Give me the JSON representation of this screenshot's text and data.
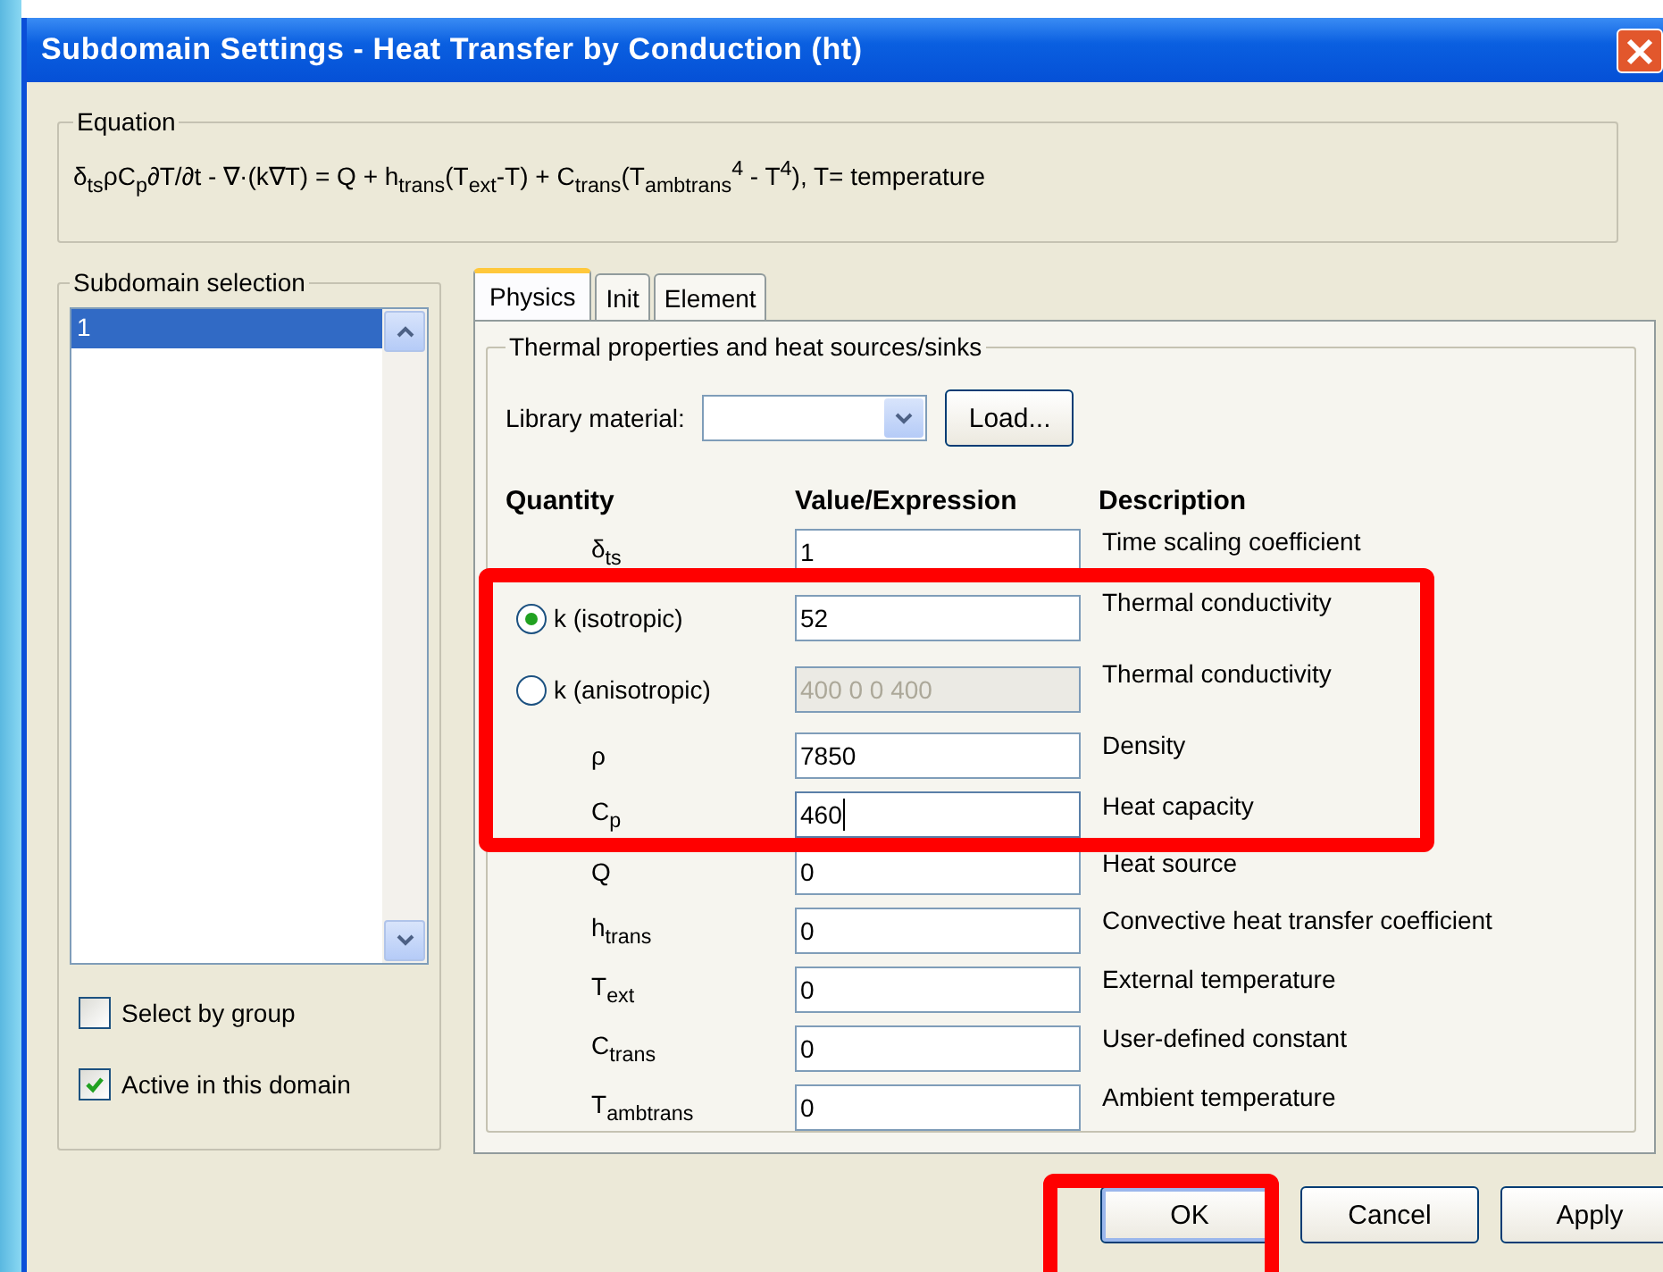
{
  "window": {
    "title": "Subdomain Settings - Heat Transfer by Conduction (ht)"
  },
  "equation": {
    "legend": "Equation",
    "formula": "δ$_{ts}$ρC$_{p}$∂T/∂t - ∇·(k∇T) = Q + h$_{trans}$(T$_{ext}$-T) + C$_{trans}$(T$_{ambtrans}$$^{4}$ - T$^{4}$), T= temperature"
  },
  "subdomain_selection": {
    "legend": "Subdomain selection",
    "items": [
      {
        "label": "1",
        "selected": true
      }
    ],
    "checkboxes": [
      {
        "label": "Select by group",
        "checked": false
      },
      {
        "label": "Active in this domain",
        "checked": true
      }
    ]
  },
  "tabs": [
    {
      "label": "Physics",
      "selected": true
    },
    {
      "label": "Init",
      "selected": false
    },
    {
      "label": "Element",
      "selected": false
    }
  ],
  "group": {
    "legend": "Thermal properties and heat sources/sinks",
    "library_label": "Library material:",
    "load_button": "Load..."
  },
  "columns": [
    "Quantity",
    "Value/Expression",
    "Description"
  ],
  "rows": [
    {
      "kind": "label",
      "quantity": "δ$_{ts}$",
      "value": "1",
      "description": "Time scaling coefficient",
      "disabled": false,
      "focused": false
    },
    {
      "kind": "radio",
      "quantity": "k (isotropic)",
      "selected": true,
      "value": "52",
      "description": "Thermal conductivity",
      "disabled": false,
      "focused": false
    },
    {
      "kind": "radio",
      "quantity": "k (anisotropic)",
      "selected": false,
      "value": "400 0 0 400",
      "description": "Thermal conductivity",
      "disabled": true,
      "focused": false
    },
    {
      "kind": "label",
      "quantity": "ρ",
      "value": "7850",
      "description": "Density",
      "disabled": false,
      "focused": false
    },
    {
      "kind": "label",
      "quantity": "C$_{p}$",
      "value": "460",
      "description": "Heat capacity",
      "disabled": false,
      "focused": true
    },
    {
      "kind": "label",
      "quantity": "Q",
      "value": "0",
      "description": "Heat source",
      "disabled": false,
      "focused": false
    },
    {
      "kind": "label",
      "quantity": "h$_{trans}$",
      "value": "0",
      "description": "Convective heat transfer coefficient",
      "disabled": false,
      "focused": false
    },
    {
      "kind": "label",
      "quantity": "T$_{ext}$",
      "value": "0",
      "description": "External temperature",
      "disabled": false,
      "focused": false
    },
    {
      "kind": "label",
      "quantity": "C$_{trans}$",
      "value": "0",
      "description": "User-defined constant",
      "disabled": false,
      "focused": false
    },
    {
      "kind": "label",
      "quantity": "T$_{ambtrans}$",
      "value": "0",
      "description": "Ambient temperature",
      "disabled": false,
      "focused": false
    }
  ],
  "buttons": [
    "OK",
    "Cancel",
    "Apply"
  ]
}
